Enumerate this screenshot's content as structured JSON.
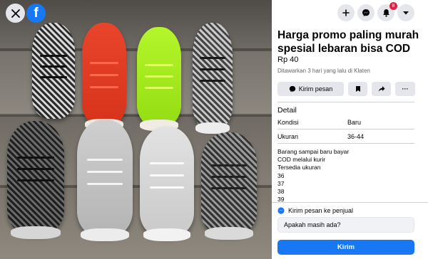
{
  "listing": {
    "title": "Harga promo paling murah spesial lebaran bisa COD",
    "price": "Rp 40",
    "posted": "Ditawarkan 3 hari yang lalu di Klaten"
  },
  "photo": {
    "close_icon": "close-icon",
    "logo_letter": "f"
  },
  "topbar": {
    "notifications_count": "8"
  },
  "actions": {
    "message_label": "Kirim pesan",
    "more_label": "···"
  },
  "details": {
    "heading": "Detail",
    "rows": [
      {
        "key": "Kondisi",
        "value": "Baru"
      },
      {
        "key": "Ukuran",
        "value": "36-44"
      }
    ],
    "description_lines": [
      "Barang sampai baru bayar",
      "COD melalui kurir",
      "Tersedia ukuran",
      "36",
      "37",
      "38",
      "39"
    ]
  },
  "seller_message": {
    "label": "Kirim pesan ke penjual",
    "input_value": "Apakah masih ada?",
    "send_label": "Kirim"
  },
  "colors": {
    "brand": "#1877f2",
    "badge": "#e41e3f",
    "button_bg": "#e4e6eb"
  }
}
